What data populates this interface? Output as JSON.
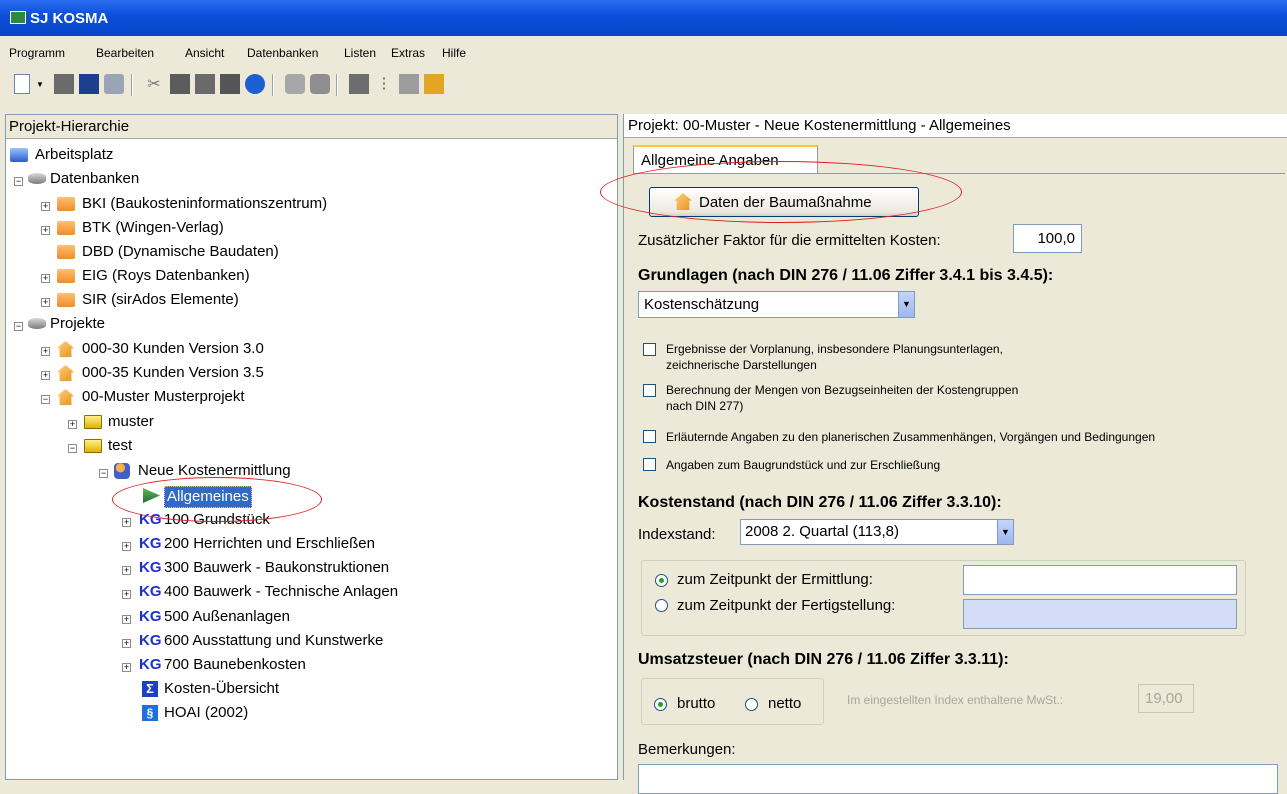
{
  "window": {
    "title": "SJ KOSMA"
  },
  "menu": [
    "Programm",
    "Bearbeiten",
    "Ansicht",
    "Datenbanken",
    "Listen",
    "Extras",
    "Hilfe"
  ],
  "left_pane": {
    "header": "Projekt-Hierarchie",
    "tree": {
      "root": "Arbeitsplatz",
      "datenbanken": "Datenbanken",
      "db_items": [
        "BKI (Baukosteninformationszentrum)",
        "BTK (Wingen-Verlag)",
        "DBD (Dynamische Baudaten)",
        "EIG (Roys Datenbanken)",
        "SIR (sirAdos Elemente)"
      ],
      "projekte": "Projekte",
      "projects": [
        "000-30 Kunden Version 3.0",
        "000-35 Kunden Version 3.5",
        "00-Muster Musterprojekt"
      ],
      "folders": [
        "muster",
        "test"
      ],
      "kostenermittlung": "Neue Kostenermittlung",
      "selected": "Allgemeines",
      "kg_prefix": "KG",
      "kg_items": [
        "100 Grundstück",
        "200 Herrichten und Erschließen",
        "300 Bauwerk - Baukonstruktionen",
        "400 Bauwerk - Technische Anlagen",
        "500 Außenanlagen",
        "600 Ausstattung und Kunstwerke",
        "700 Baunebenkosten"
      ],
      "sum_icon": "Σ",
      "para_icon": "§",
      "uebersicht": "Kosten-Übersicht",
      "hoai": "HOAI (2002)"
    }
  },
  "right_pane": {
    "header": "Projekt: 00-Muster - Neue Kostenermittlung - Allgemeines",
    "tab": "Allgemeine Angaben",
    "button_daten": "Daten der Baumaßnahme",
    "faktor_label": "Zusätzlicher Faktor für die ermittelten Kosten:",
    "faktor_value": "100,0",
    "grundlagen_heading": "Grundlagen (nach DIN 276 / 11.06 Ziffer 3.4.1 bis 3.4.5):",
    "grundlagen_select": "Kostenschätzung",
    "checkboxes": [
      {
        "line1": "Ergebnisse der Vorplanung, insbesondere Planungsunterlagen,",
        "line2": "zeichnerische Darstellungen"
      },
      {
        "line1": "Berechnung der Mengen von Bezugseinheiten der Kostengruppen",
        "line2": "nach DIN 277)"
      },
      {
        "line1": "Erläuternde Angaben zu den planerischen Zusammenhängen, Vorgängen und Bedingungen",
        "line2": ""
      },
      {
        "line1": "Angaben zum Baugrundstück und zur Erschließung",
        "line2": ""
      }
    ],
    "kostenstand_heading": "Kostenstand (nach DIN 276 / 11.06 Ziffer 3.3.10):",
    "indexstand_label": "Indexstand:",
    "indexstand_value": "2008 2. Quartal (113,8)",
    "radio_ermittlung": "zum Zeitpunkt der Ermittlung:",
    "radio_fertigstellung": "zum Zeitpunkt der Fertigstellung:",
    "ust_heading": "Umsatzsteuer (nach DIN 276 / 11.06 Ziffer 3.3.11):",
    "radio_brutto": "brutto",
    "radio_netto": "netto",
    "mwst_label": "Im eingestellten Index enthaltene MwSt.:",
    "mwst_value": "19,00",
    "bemerkungen_label": "Bemerkungen:"
  }
}
